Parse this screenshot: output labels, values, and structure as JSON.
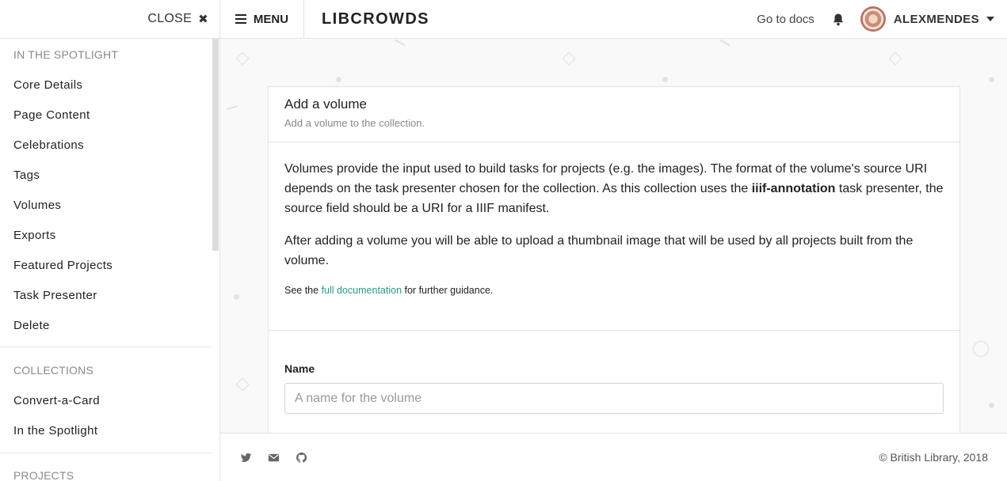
{
  "sidebar": {
    "close_label": "CLOSE",
    "sections": [
      {
        "title": "IN THE SPOTLIGHT",
        "items": [
          "Core Details",
          "Page Content",
          "Celebrations",
          "Tags",
          "Volumes",
          "Exports",
          "Featured Projects",
          "Task Presenter",
          "Delete"
        ]
      },
      {
        "title": "COLLECTIONS",
        "items": [
          "Convert-a-Card",
          "In the Spotlight"
        ]
      },
      {
        "title": "PROJECTS",
        "items": []
      }
    ]
  },
  "header": {
    "menu_label": "MENU",
    "brand": "LIBCROWDS",
    "docs_link": "Go to docs",
    "username": "ALEXMENDES"
  },
  "card": {
    "title": "Add a volume",
    "subtitle": "Add a volume to the collection.",
    "para1_a": "Volumes provide the input used to build tasks for projects (e.g. the images). The format of the volume's source URI depends on the task presenter chosen for the collection. As this collection uses the ",
    "para1_bold": "iiif-annotation",
    "para1_b": " task presenter, the source field should be a URI for a IIIF manifest.",
    "para2": "After adding a volume you will be able to upload a thumbnail image that will be used by all projects built from the volume.",
    "note_pre": "See the ",
    "note_link": "full documentation",
    "note_post": " for further guidance.",
    "name_label": "Name",
    "name_placeholder": "A name for the volume",
    "name_value": ""
  },
  "footer": {
    "copyright": "© British Library, 2018"
  },
  "icons": {
    "close": "close-icon",
    "menu": "hamburger-icon",
    "bell": "bell-icon",
    "caret": "chevron-down-icon",
    "twitter": "twitter-icon",
    "email": "email-icon",
    "github": "github-icon"
  }
}
